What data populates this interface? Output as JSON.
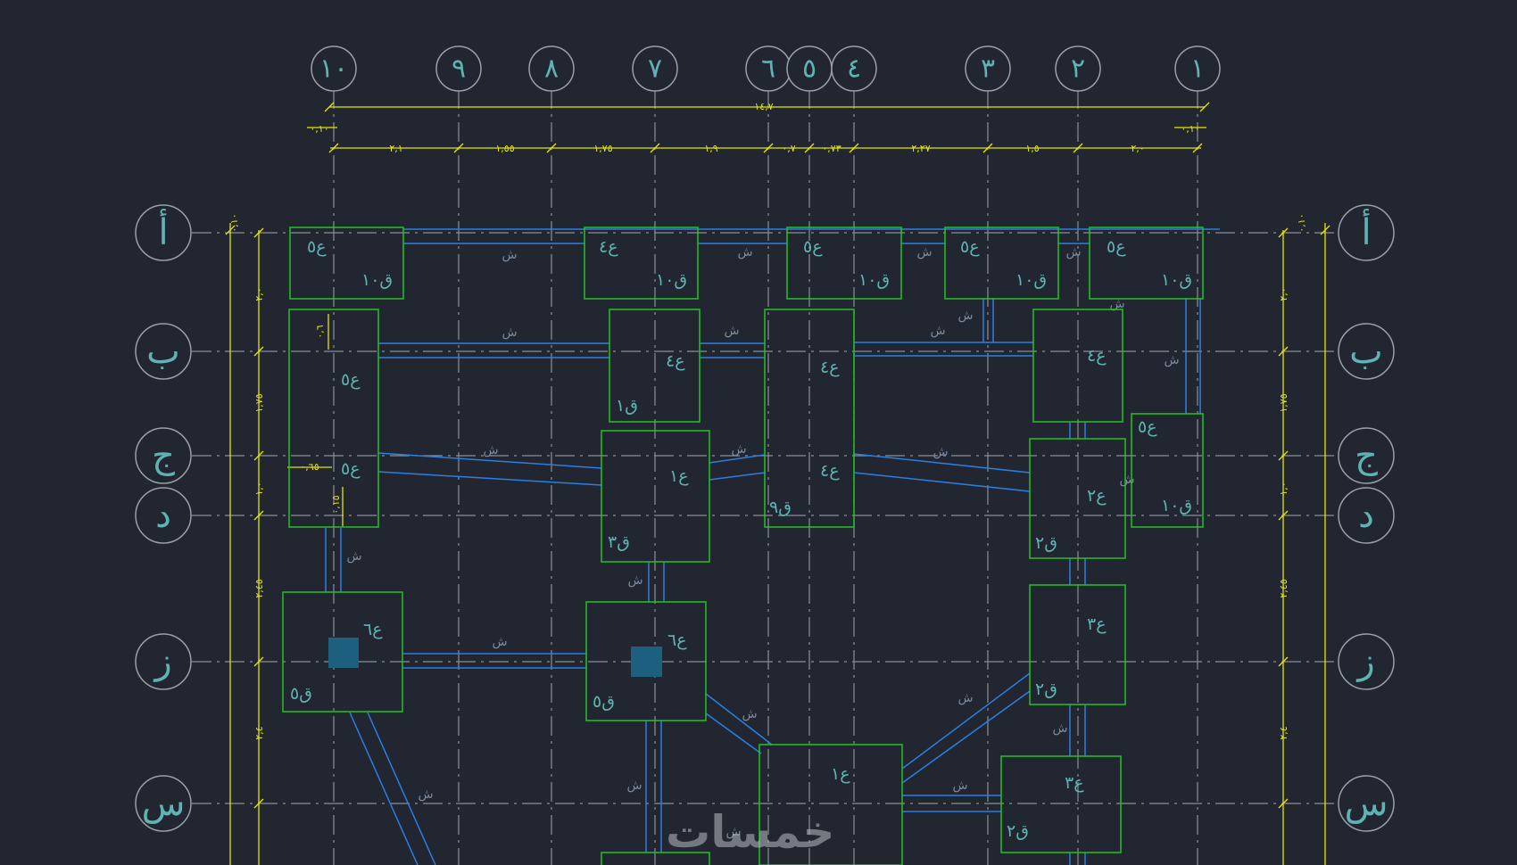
{
  "drawing": {
    "colors": {
      "background": "#212630",
      "grid": "#8a8f96",
      "dimension": "#e6e600",
      "footing": "#22c422",
      "beam": "#2a7fe0",
      "label": "#5fb3b3",
      "column": "#1d5f7f"
    },
    "vertical_axes": [
      "١٠",
      "٩",
      "٨",
      "٧",
      "٦",
      "٥",
      "٤",
      "٣",
      "٢",
      "١"
    ],
    "horizontal_axes": [
      "أ",
      "ب",
      "ج",
      "د",
      "ز",
      "س"
    ],
    "dimensions": {
      "overall": "١٤,٧",
      "edge_left": "٠,١٠",
      "edge_right": "٠,١٠",
      "spans": [
        "٢,١",
        "١,٥٥",
        "١,٧٥",
        "١,٩",
        "٠,٧",
        "٠,٧٣",
        "٢,٢٧",
        "١,٥",
        "٢,٠"
      ],
      "side_spans": [
        "٠,١٠",
        "٢,٠",
        "١,٧٥",
        "١,٠",
        "٢,٤٥",
        "٢,٤"
      ],
      "local": [
        "٠,٦",
        "٠,٦٥",
        "٠,١٥"
      ]
    },
    "footings": [
      {
        "id": "a10",
        "type": "ع٥",
        "rebar": "ق١٠"
      },
      {
        "id": "a7",
        "type": "ع٤",
        "rebar": "ق١٠"
      },
      {
        "id": "a5",
        "type": "ع٥",
        "rebar": "ق١٠"
      },
      {
        "id": "a3",
        "type": "ع٥",
        "rebar": "ق١٠"
      },
      {
        "id": "a1",
        "type": "ع٥",
        "rebar": "ق١٠"
      },
      {
        "id": "b10",
        "type": "ع٥",
        "type2": "ع٥"
      },
      {
        "id": "b7",
        "type": "ع٤",
        "rebar": "ق١"
      },
      {
        "id": "b5",
        "type": "ع٤",
        "type2": "ع٤",
        "rebar": "ق٩"
      },
      {
        "id": "b2",
        "type": "ع٤"
      },
      {
        "id": "c1",
        "type": "ع٥",
        "rebar": "ق١٠"
      },
      {
        "id": "c7",
        "type": "ع١",
        "rebar": "ق٣"
      },
      {
        "id": "c2",
        "type": "ع٢",
        "rebar": "ق٢"
      },
      {
        "id": "z10",
        "type": "ع٦",
        "rebar": "ق٥"
      },
      {
        "id": "z7",
        "type": "ع٦",
        "rebar": "ق٥"
      },
      {
        "id": "z2",
        "type": "ع٣",
        "rebar": "ق٢"
      },
      {
        "id": "s5",
        "type": "ع١"
      },
      {
        "id": "s2",
        "type": "ع٣",
        "rebar": "ق٢"
      }
    ],
    "beam_label": "ش",
    "watermark": "خمسات"
  }
}
